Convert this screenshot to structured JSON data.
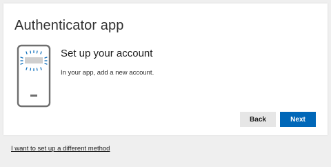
{
  "card": {
    "title": "Authenticator app",
    "heading": "Set up your account",
    "instruction": "In your app, add a new account."
  },
  "actions": {
    "back_label": "Back",
    "next_label": "Next"
  },
  "footer": {
    "alternate_method_link": "I want to set up a different method"
  },
  "colors": {
    "primary": "#0067b8",
    "secondary_button": "#e6e6e6",
    "page_background": "#efefef",
    "card_background": "#ffffff",
    "icon_stroke": "#6e6e6e"
  },
  "icons": {
    "phone": "phone-with-account-icon"
  }
}
